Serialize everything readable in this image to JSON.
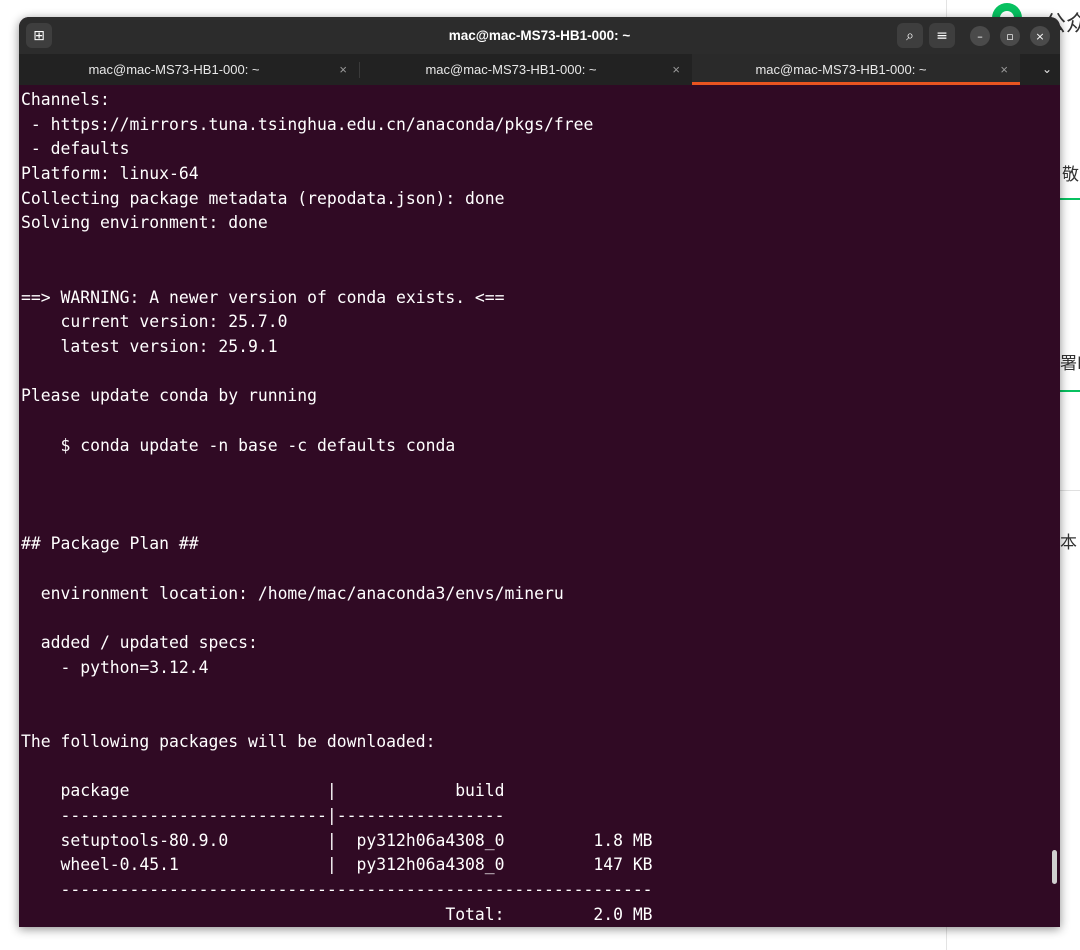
{
  "window": {
    "title": "mac@mac-MS73-HB1-000: ~",
    "tabs": [
      {
        "label": "mac@mac-MS73-HB1-000: ~",
        "close": "×"
      },
      {
        "label": "mac@mac-MS73-HB1-000: ~",
        "close": "×"
      },
      {
        "label": "mac@mac-MS73-HB1-000: ~",
        "close": "×"
      }
    ],
    "tab_menu_glyph": "⌄",
    "new_tab_glyph": "⊞",
    "search_glyph": "⌕",
    "menu_glyph": "≡",
    "minimize_glyph": "–",
    "maximize_glyph": "▫",
    "close_glyph": "×"
  },
  "background_app": {
    "snippets": [
      "公众",
      "敬",
      "署M",
      "本"
    ],
    "accent_color": "#07c160"
  },
  "terminal": {
    "lines": [
      "Channels:",
      " - https://mirrors.tuna.tsinghua.edu.cn/anaconda/pkgs/free",
      " - defaults",
      "Platform: linux-64",
      "Collecting package metadata (repodata.json): done",
      "Solving environment: done",
      "",
      "",
      "==> WARNING: A newer version of conda exists. <==",
      "    current version: 25.7.0",
      "    latest version: 25.9.1",
      "",
      "Please update conda by running",
      "",
      "    $ conda update -n base -c defaults conda",
      "",
      "",
      "",
      "## Package Plan ##",
      "",
      "  environment location: /home/mac/anaconda3/envs/mineru",
      "",
      "  added / updated specs:",
      "    - python=3.12.4",
      "",
      "",
      "The following packages will be downloaded:",
      "",
      "    package                    |            build",
      "    ---------------------------|-----------------",
      "    setuptools-80.9.0          |  py312h06a4308_0         1.8 MB",
      "    wheel-0.45.1               |  py312h06a4308_0         147 KB",
      "    ------------------------------------------------------------",
      "                                           Total:         2.0 MB"
    ]
  }
}
